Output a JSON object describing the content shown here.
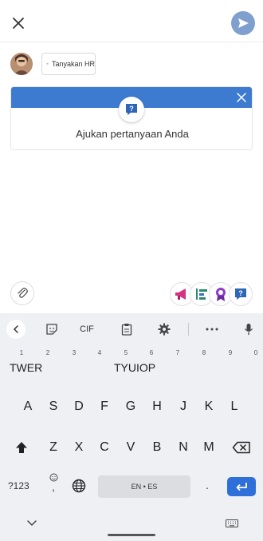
{
  "header": {
    "close_icon": "close-icon",
    "send_icon": "send-icon",
    "send_color": "#7f9fcf"
  },
  "audience": {
    "chip_label": "Tanyakan HR"
  },
  "card": {
    "title": "Ajukan pertanyaan Anda",
    "band_color": "#3d7bd1"
  },
  "apps": [
    "megaphone-app",
    "align-app",
    "badge-app",
    "question-app"
  ],
  "keyboard": {
    "clipboard_label": "CIF",
    "number_hints": [
      "1",
      "2",
      "3",
      "4",
      "5",
      "6",
      "7",
      "8",
      "9",
      "0"
    ],
    "suggestions": [
      "TWER",
      "TYUIOP"
    ],
    "row1": [
      "A",
      "S",
      "D",
      "F",
      "G",
      "H",
      "J",
      "K",
      "L"
    ],
    "row2": [
      "Z",
      "X",
      "C",
      "V",
      "B",
      "N",
      "M"
    ],
    "sym_label": "?123",
    "emoji_sub": ",",
    "space_label": "EN • ES",
    "period_label": ".",
    "enter_color": "#2e6fd9"
  }
}
